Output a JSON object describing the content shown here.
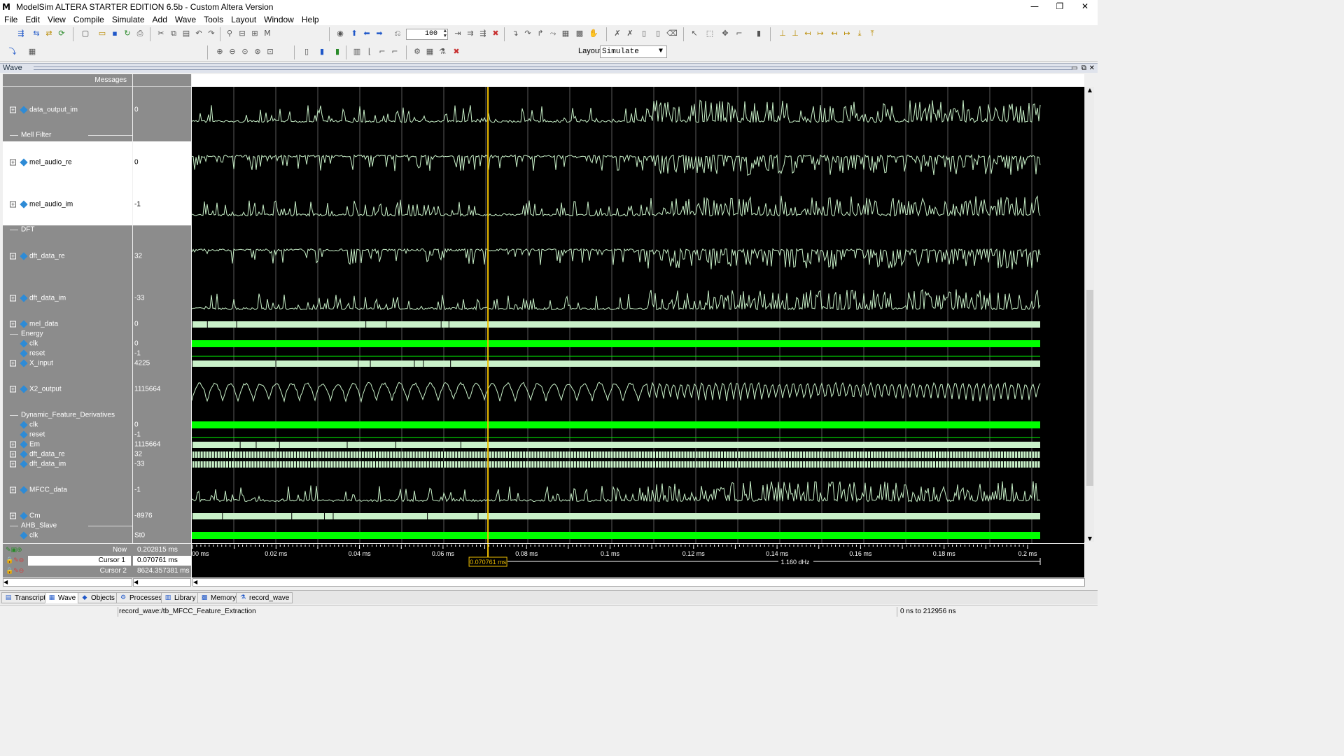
{
  "window": {
    "logo": "M",
    "title": "ModelSim ALTERA STARTER EDITION 6.5b - Custom Altera Version",
    "minimize": "—",
    "restore": "❐",
    "close": "✕"
  },
  "menu": [
    "File",
    "Edit",
    "View",
    "Compile",
    "Simulate",
    "Add",
    "Wave",
    "Tools",
    "Layout",
    "Window",
    "Help"
  ],
  "toolbar": {
    "zoom_value": "100",
    "layout_label": "Layout",
    "layout_value": "Simulate"
  },
  "wave_window": {
    "title": "Wave",
    "messages_header": "Messages"
  },
  "signals": [
    {
      "name": "data_output_im",
      "value": "0",
      "expandable": true,
      "kind": "analog"
    },
    {
      "group": "Mell Filter"
    },
    {
      "name": "mel_audio_re",
      "value": "0",
      "expandable": true,
      "kind": "analog",
      "selected": true
    },
    {
      "name": "mel_audio_im",
      "value": "-1",
      "expandable": true,
      "kind": "analog",
      "selected": true
    },
    {
      "group": "DFT"
    },
    {
      "name": "dft_data_re",
      "value": "32",
      "expandable": true,
      "kind": "analog"
    },
    {
      "name": "dft_data_im",
      "value": "-33",
      "expandable": true,
      "kind": "analog"
    },
    {
      "name": "mel_data",
      "value": "0",
      "expandable": true,
      "kind": "bus"
    },
    {
      "group": "Energy"
    },
    {
      "name": "clk",
      "value": "0",
      "expandable": false,
      "kind": "clock"
    },
    {
      "name": "reset",
      "value": "-1",
      "expandable": false,
      "kind": "low"
    },
    {
      "name": "X_input",
      "value": "4225",
      "expandable": true,
      "kind": "bus"
    },
    {
      "name": "X2_output",
      "value": "1115664",
      "expandable": true,
      "kind": "analog"
    },
    {
      "group": "Dynamic_Feature_Derivatives"
    },
    {
      "name": "clk",
      "value": "0",
      "expandable": false,
      "kind": "clock"
    },
    {
      "name": "reset",
      "value": "-1",
      "expandable": false,
      "kind": "low"
    },
    {
      "name": "Em",
      "value": "1115664",
      "expandable": true,
      "kind": "bus"
    },
    {
      "name": "dft_data_re",
      "value": "32",
      "expandable": true,
      "kind": "busdense"
    },
    {
      "name": "dft_data_im",
      "value": "-33",
      "expandable": true,
      "kind": "busdense"
    },
    {
      "name": "MFCC_data",
      "value": "-1",
      "expandable": true,
      "kind": "analog"
    },
    {
      "name": "Cm",
      "value": "-8976",
      "expandable": true,
      "kind": "bus"
    },
    {
      "group": "AHB_Slave"
    },
    {
      "name": "clk",
      "value": "St0",
      "expandable": false,
      "kind": "clock"
    }
  ],
  "cursors": {
    "now_label": "Now",
    "now_value": "0.202815 ms",
    "cursor1_label": "Cursor 1",
    "cursor1_value": "0.070761 ms",
    "cursor2_label": "Cursor 2",
    "cursor2_value": "8624.357381 ms",
    "cursor1_marker": "0.070761 ms",
    "cursor1_time_ms": 0.070761,
    "delta_label": "1.160 dHz"
  },
  "timeline": {
    "ticks": [
      "00 ms",
      "0.02 ms",
      "0.04 ms",
      "0.06 ms",
      "0.08 ms",
      "0.1 ms",
      "0.12 ms",
      "0.14 ms",
      "0.16 ms",
      "0.18 ms",
      "0.2 ms"
    ],
    "start_ms": 0,
    "end_ms": 0.2028
  },
  "tabs": [
    {
      "label": "Transcript",
      "icon": "transcript-icon",
      "active": false
    },
    {
      "label": "Wave",
      "icon": "wave-icon",
      "active": true
    },
    {
      "label": "Objects",
      "icon": "objects-icon",
      "active": false
    },
    {
      "label": "Processes",
      "icon": "processes-icon",
      "active": false
    },
    {
      "label": "Library",
      "icon": "library-icon",
      "active": false
    },
    {
      "label": "Memory",
      "icon": "memory-icon",
      "active": false
    },
    {
      "label": "record_wave",
      "icon": "record-wave-icon",
      "active": false
    }
  ],
  "status": {
    "path": "record_wave:/tb_MFCC_Feature_Extraction",
    "range": "0 ns to 212956 ns"
  },
  "colors": {
    "wave": "#c8f0c8",
    "clock": "#00ff00",
    "cursor": "#f0c000",
    "background": "#000000"
  }
}
